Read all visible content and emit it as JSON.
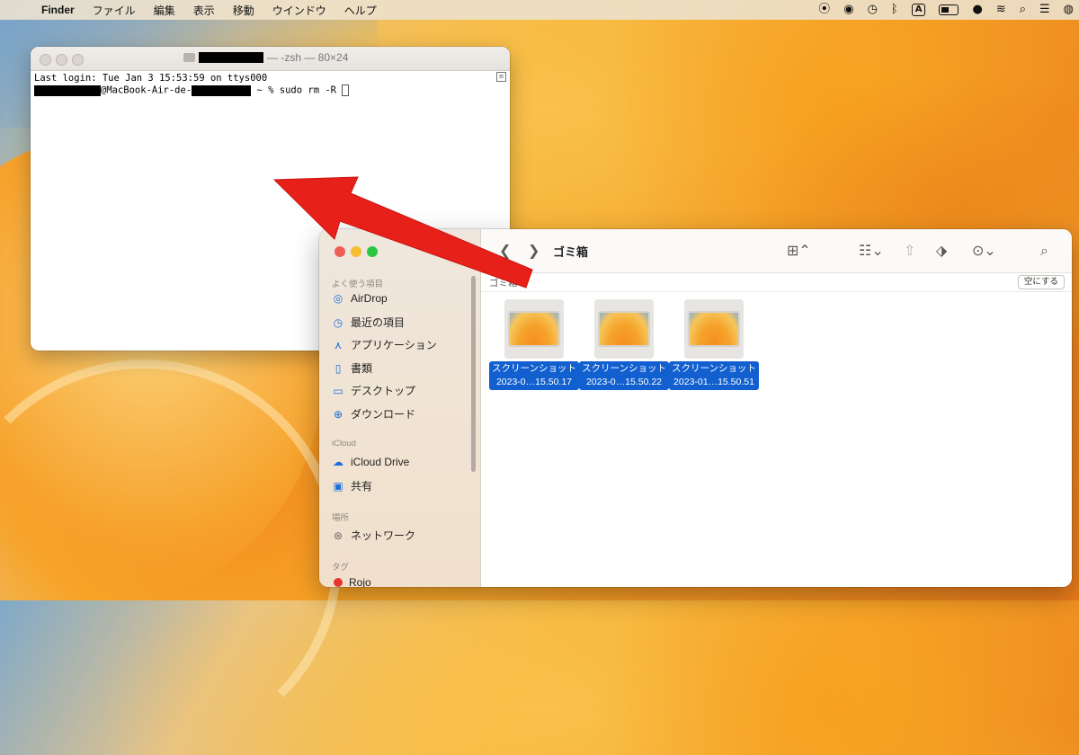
{
  "menubar": {
    "app": "Finder",
    "items": [
      "ファイル",
      "編集",
      "表示",
      "移動",
      "ウインドウ",
      "ヘルプ"
    ],
    "input_source": "A"
  },
  "terminal": {
    "title_suffix": "— -zsh — 80×24",
    "line1": "Last login: Tue Jan  3 15:53:59 on ttys000",
    "prompt_host": "@MacBook-Air-de-",
    "command": " ~ % sudo rm -R "
  },
  "finder": {
    "title": "ゴミ箱",
    "path_label": "ゴミ箱",
    "empty_button": "空にする",
    "sidebar": {
      "favorites_header": "よく使う項目",
      "favorites": [
        {
          "label": "AirDrop",
          "icon": "airdrop-icon"
        },
        {
          "label": "最近の項目",
          "icon": "clock-icon"
        },
        {
          "label": "アプリケーション",
          "icon": "applications-icon"
        },
        {
          "label": "書類",
          "icon": "document-icon"
        },
        {
          "label": "デスクトップ",
          "icon": "desktop-icon"
        },
        {
          "label": "ダウンロード",
          "icon": "download-icon"
        }
      ],
      "icloud_header": "iCloud",
      "icloud": [
        {
          "label": "iCloud Drive",
          "icon": "cloud-icon"
        },
        {
          "label": "共有",
          "icon": "shared-folder-icon"
        }
      ],
      "locations_header": "場所",
      "locations": [
        {
          "label": "ネットワーク",
          "icon": "network-icon"
        }
      ],
      "tags_header": "タグ",
      "tags": [
        {
          "label": "Rojo",
          "color": "#e8362f"
        }
      ]
    },
    "files": [
      {
        "line1": "スクリーンショット",
        "line2": "2023-0…15.50.17"
      },
      {
        "line1": "スクリーンショット",
        "line2": "2023-0…15.50.22"
      },
      {
        "line1": "スクリーンショット",
        "line2": "2023-01…15.50.51"
      }
    ]
  },
  "colors": {
    "selection": "#1260cf",
    "arrow": "#e8201a",
    "close": "#ee5f57",
    "minimize": "#f5bd2f",
    "zoom": "#28c840"
  }
}
